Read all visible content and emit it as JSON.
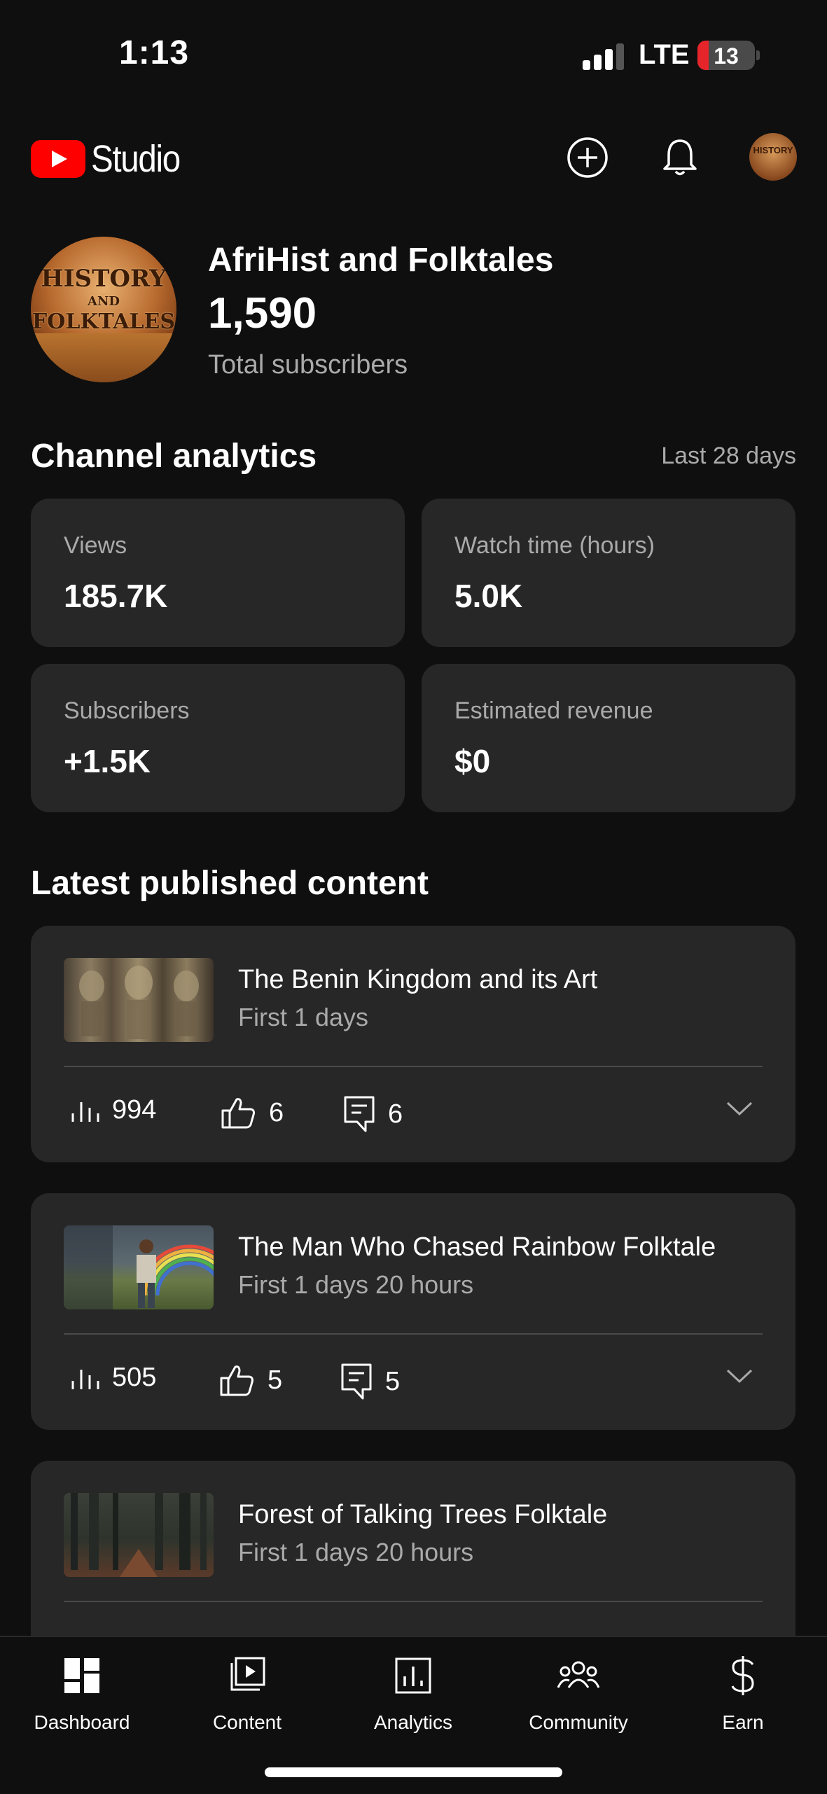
{
  "status_bar": {
    "time": "1:13",
    "network": "LTE",
    "battery": "13"
  },
  "header": {
    "logo_text": "Studio",
    "icons": [
      "create-icon",
      "bell-icon",
      "avatar"
    ]
  },
  "channel": {
    "name": "AfriHist and Folktales",
    "subscribers": "1,590",
    "subscribers_label": "Total subscribers",
    "avatar_text": [
      "HISTORY",
      "AND",
      "FOLKTALES"
    ]
  },
  "analytics": {
    "title": "Channel analytics",
    "period": "Last 28 days",
    "cards": [
      {
        "label": "Views",
        "value": "185.7K"
      },
      {
        "label": "Watch time (hours)",
        "value": "5.0K"
      },
      {
        "label": "Subscribers",
        "value": "+1.5K"
      },
      {
        "label": "Estimated revenue",
        "value": "$0"
      }
    ]
  },
  "latest": {
    "title": "Latest published content",
    "items": [
      {
        "title": "The Benin Kingdom and its Art",
        "subtitle": "First 1 days",
        "views": "994",
        "likes": "6",
        "comments": "6"
      },
      {
        "title": "The Man Who Chased Rainbow Folktale",
        "subtitle": "First 1 days 20 hours",
        "views": "505",
        "likes": "5",
        "comments": "5"
      },
      {
        "title": "Forest of Talking Trees Folktale",
        "subtitle": "First 1 days 20 hours",
        "views": "",
        "likes": "",
        "comments": ""
      }
    ]
  },
  "nav": {
    "items": [
      {
        "label": "Dashboard",
        "icon": "dashboard-icon"
      },
      {
        "label": "Content",
        "icon": "content-icon"
      },
      {
        "label": "Analytics",
        "icon": "analytics-icon"
      },
      {
        "label": "Community",
        "icon": "community-icon"
      },
      {
        "label": "Earn",
        "icon": "dollar-icon"
      }
    ]
  },
  "colors": {
    "background": "#0f0f0f",
    "card": "#272727",
    "brand": "#ff0000",
    "muted_text": "#aaaaaa"
  }
}
